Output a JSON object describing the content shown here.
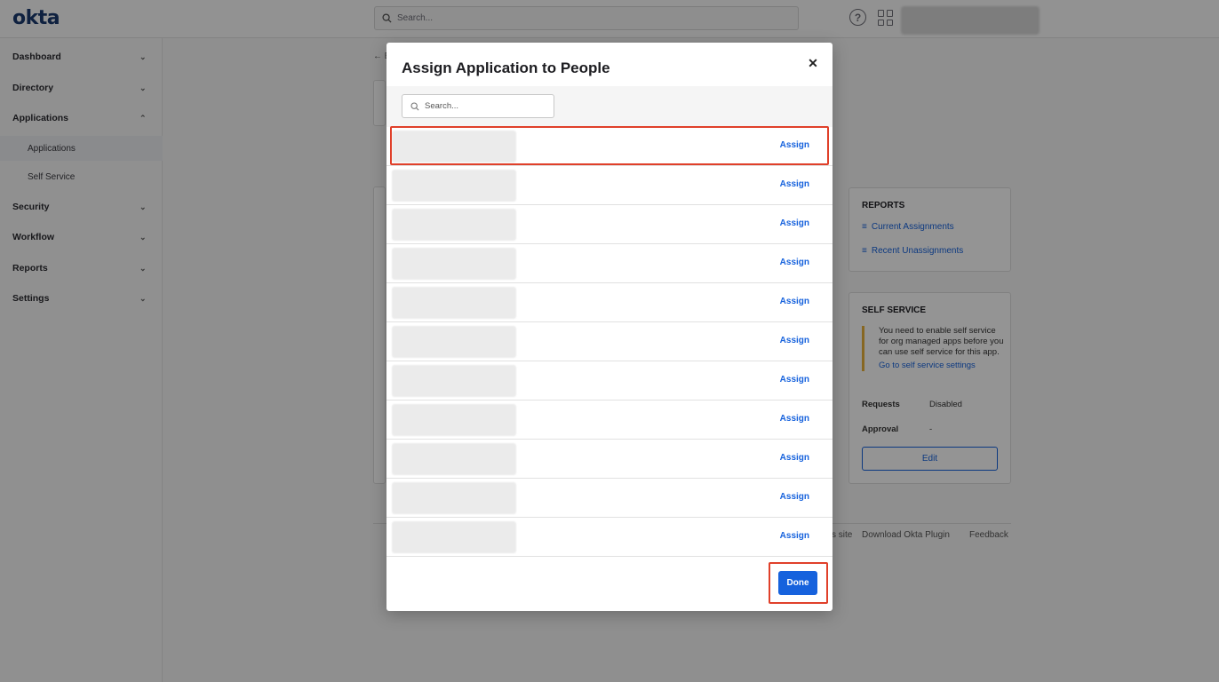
{
  "topbar": {
    "logo": "okta",
    "search_placeholder": "Search..."
  },
  "sidebar": {
    "items": [
      {
        "label": "Dashboard"
      },
      {
        "label": "Directory"
      },
      {
        "label": "Applications"
      },
      {
        "label": "Security"
      },
      {
        "label": "Workflow"
      },
      {
        "label": "Reports"
      },
      {
        "label": "Settings"
      }
    ],
    "subitems": [
      {
        "label": "Applications"
      },
      {
        "label": "Self Service"
      }
    ]
  },
  "background": {
    "reports_title": "REPORTS",
    "current_assignments": "Current Assignments",
    "recent_unassignments": "Recent Unassignments",
    "self_service_title": "SELF SERVICE",
    "self_service_note": "You need to enable self service for org managed apps before you can use self service for this app.",
    "self_service_link": "Go to self service settings",
    "requests_label": "Requests",
    "requests_value": "Disabled",
    "approval_label": "Approval",
    "approval_value": "-",
    "edit_label": "Edit",
    "footer_site": "s site",
    "footer_plugin": "Download Okta Plugin",
    "footer_feedback": "Feedback"
  },
  "modal": {
    "title": "Assign Application to People",
    "search_placeholder": "Search...",
    "assign_label": "Assign",
    "row_count": 11,
    "done_label": "Done"
  }
}
